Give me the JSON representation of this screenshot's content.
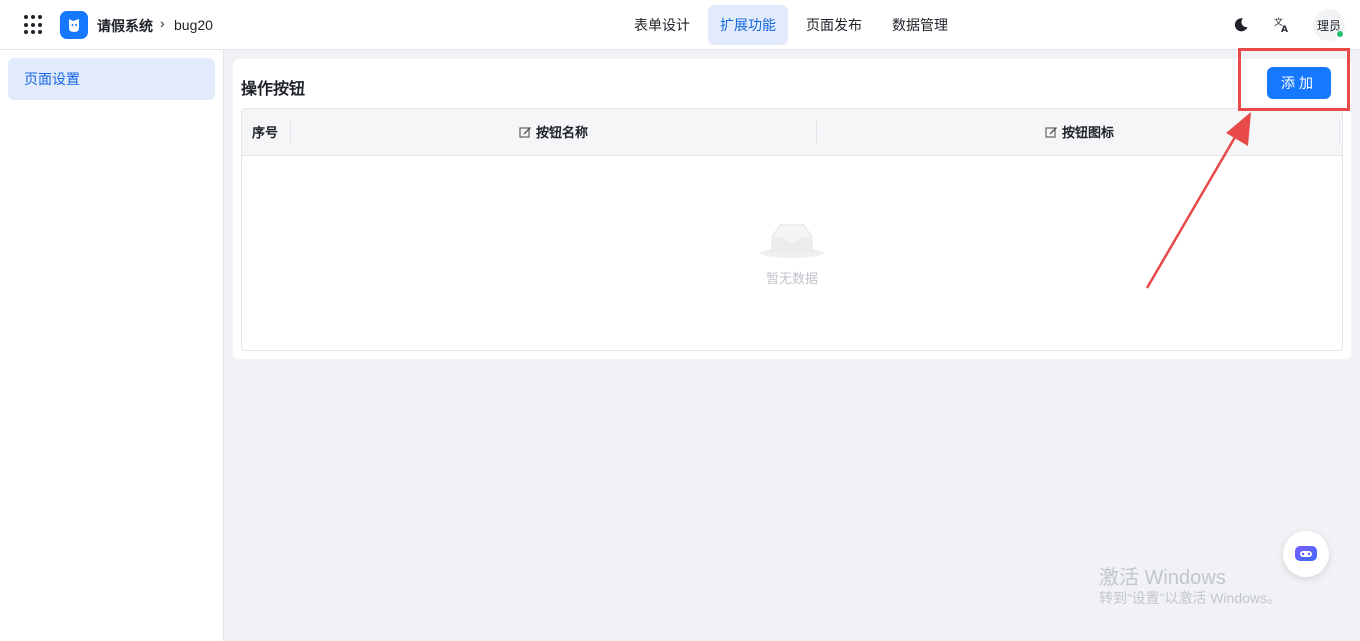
{
  "header": {
    "app_name": "请假系统",
    "breadcrumb_sep": "›",
    "app_id": "bug20",
    "tabs": [
      {
        "label": "表单设计",
        "active": false
      },
      {
        "label": "扩展功能",
        "active": true
      },
      {
        "label": "页面发布",
        "active": false
      },
      {
        "label": "数据管理",
        "active": false
      }
    ],
    "avatar_text": "理员",
    "icons": [
      "apps-grid-icon",
      "app-logo-icon",
      "moon-icon",
      "translate-icon"
    ]
  },
  "sidebar": {
    "items": [
      {
        "label": "页面设置",
        "active": true
      }
    ]
  },
  "main": {
    "section_title": "操作按钮",
    "add_button_label": "添加",
    "table": {
      "columns": [
        "序号",
        "按钮名称",
        "按钮图标"
      ],
      "empty_text": "暂无数据"
    }
  },
  "watermark": {
    "line1": "激活 Windows",
    "line2": "转到“设置”以激活 Windows。"
  },
  "colors": {
    "primary": "#1677ff",
    "active_bg": "#e1ebfc",
    "annotation_red": "#e84a4a"
  }
}
